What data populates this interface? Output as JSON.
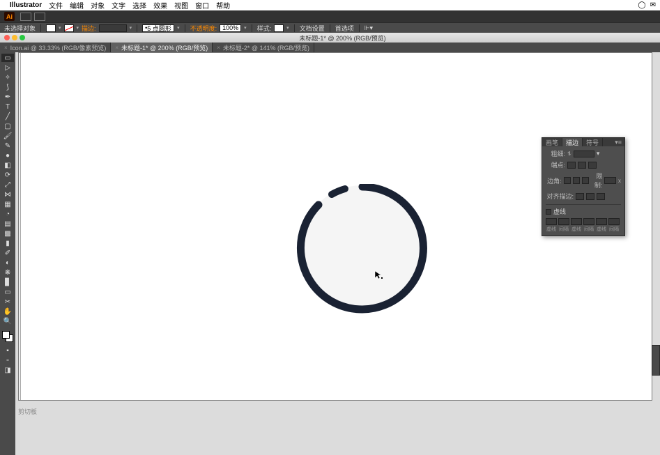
{
  "mac_menu": {
    "app": "Illustrator",
    "items": [
      "文件",
      "编辑",
      "对象",
      "文字",
      "选择",
      "效果",
      "视图",
      "窗口",
      "帮助"
    ]
  },
  "app_bar": {
    "ai_label": "Ai"
  },
  "control_bar": {
    "no_selection": "未选择对象",
    "stroke_label": "描边:",
    "stroke_weight": "5 点圆形",
    "opacity_label": "不透明度:",
    "opacity_value": "100%",
    "style_label": "样式:",
    "doc_setup": "文档设置",
    "prefs": "首选项"
  },
  "titlebar": {
    "title": "未标题-1* @ 200% (RGB/预览)"
  },
  "tabs": [
    {
      "label": "Icon.ai @ 33.33% (RGB/像素预览)",
      "active": false
    },
    {
      "label": "未标题-1* @ 200% (RGB/预览)",
      "active": true
    },
    {
      "label": "未标题-2* @ 141% (RGB/预览)",
      "active": false
    }
  ],
  "status": "剪切板",
  "stroke_panel": {
    "tabs": [
      "画笔",
      "描边",
      "符号"
    ],
    "active_tab": 1,
    "weight_label": "粗细:",
    "cap_label": "端点:",
    "corner_label": "边角:",
    "limit_label": "限制:",
    "align_label": "对齐描边:",
    "dash_label": "虚线",
    "dash_cols": [
      "虚线",
      "间隔",
      "虚线",
      "间隔",
      "虚线",
      "间隔"
    ]
  }
}
